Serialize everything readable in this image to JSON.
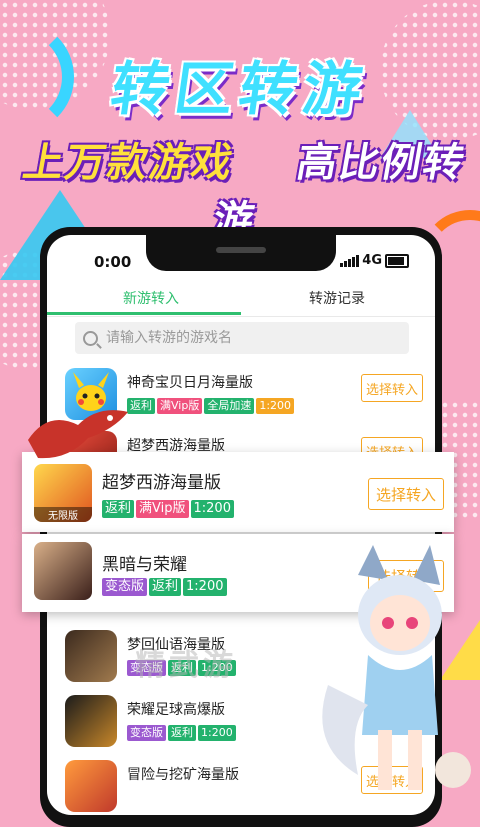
{
  "banner": {
    "title": "转区转游",
    "subtitle_left": "上万款游戏",
    "subtitle_right": "高比例转游"
  },
  "status_bar": {
    "time": "0:00",
    "network": "4G"
  },
  "tabs": [
    {
      "label": "新游转入",
      "active": true
    },
    {
      "label": "转游记录",
      "active": false
    }
  ],
  "search": {
    "placeholder": "请输入转游的游戏名"
  },
  "games": [
    {
      "name": "神奇宝贝日月海量版",
      "tags": [
        "返利",
        "满Vip版",
        "全局加速",
        "1:200"
      ],
      "button": "选择转入"
    },
    {
      "name": "超梦西游海量版",
      "tags": [],
      "button": "选择转入"
    },
    {
      "name": "梦回仙语海量版",
      "tags": [
        "变态版",
        "返利",
        "1:200"
      ],
      "button": ""
    },
    {
      "name": "荣耀足球高爆版",
      "tags": [
        "变态版",
        "返利",
        "1:200"
      ],
      "button": ""
    },
    {
      "name": "冒险与挖矿海量版",
      "tags": [],
      "button": "选择转入"
    }
  ],
  "popup_cards": [
    {
      "name": "超梦西游海量版",
      "tags": [
        "返利",
        "满Vip版",
        "1:200"
      ],
      "button": "选择转入",
      "icon_text": "无限版"
    },
    {
      "name": "黑暗与荣耀",
      "tags": [
        "变态版",
        "返利",
        "1:200"
      ],
      "button": "选择转入"
    }
  ],
  "watermark": "精武游",
  "colors": {
    "accent_green": "#2fbf6f",
    "button_orange": "#f5a623",
    "background_pink": "#f7a9c4"
  }
}
